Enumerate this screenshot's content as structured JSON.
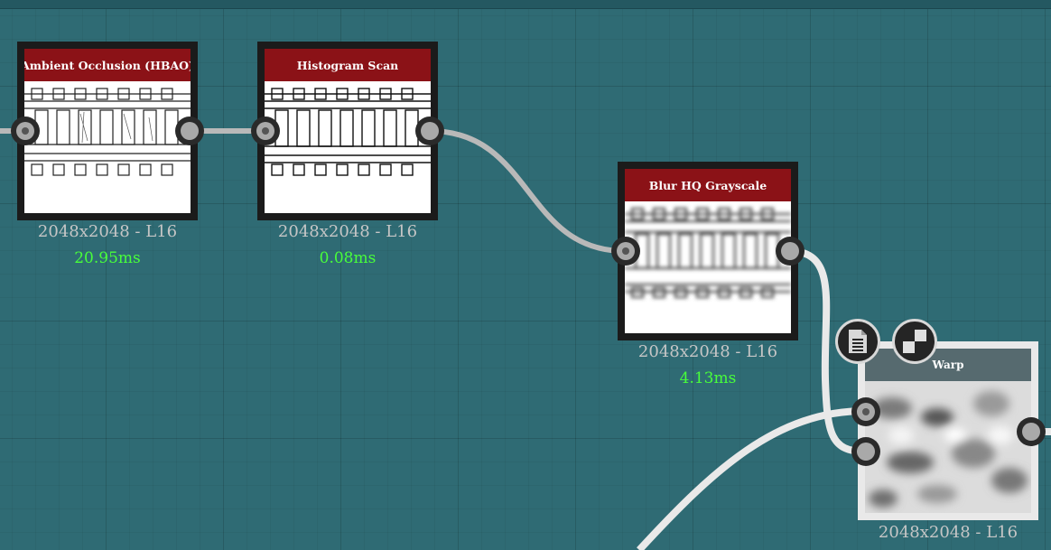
{
  "nodes": {
    "ao": {
      "title": "Ambient Occlusion (HBAO)",
      "size": "2048x2048 - L16",
      "time": "20.95ms"
    },
    "histogram": {
      "title": "Histogram Scan",
      "size": "2048x2048 - L16",
      "time": "0.08ms"
    },
    "blur": {
      "title": "Blur HQ Grayscale",
      "size": "2048x2048 - L16",
      "time": "4.13ms"
    },
    "warp": {
      "title": "Warp",
      "size": "2048x2048 - L16"
    }
  },
  "colors": {
    "canvas": "#2f6b74",
    "node_title": "#8b1217",
    "warp_title": "#566a6f",
    "time_text": "#48ff3a",
    "size_text": "#c6c6c6"
  },
  "icons": [
    "document-icon",
    "checker-icon"
  ]
}
